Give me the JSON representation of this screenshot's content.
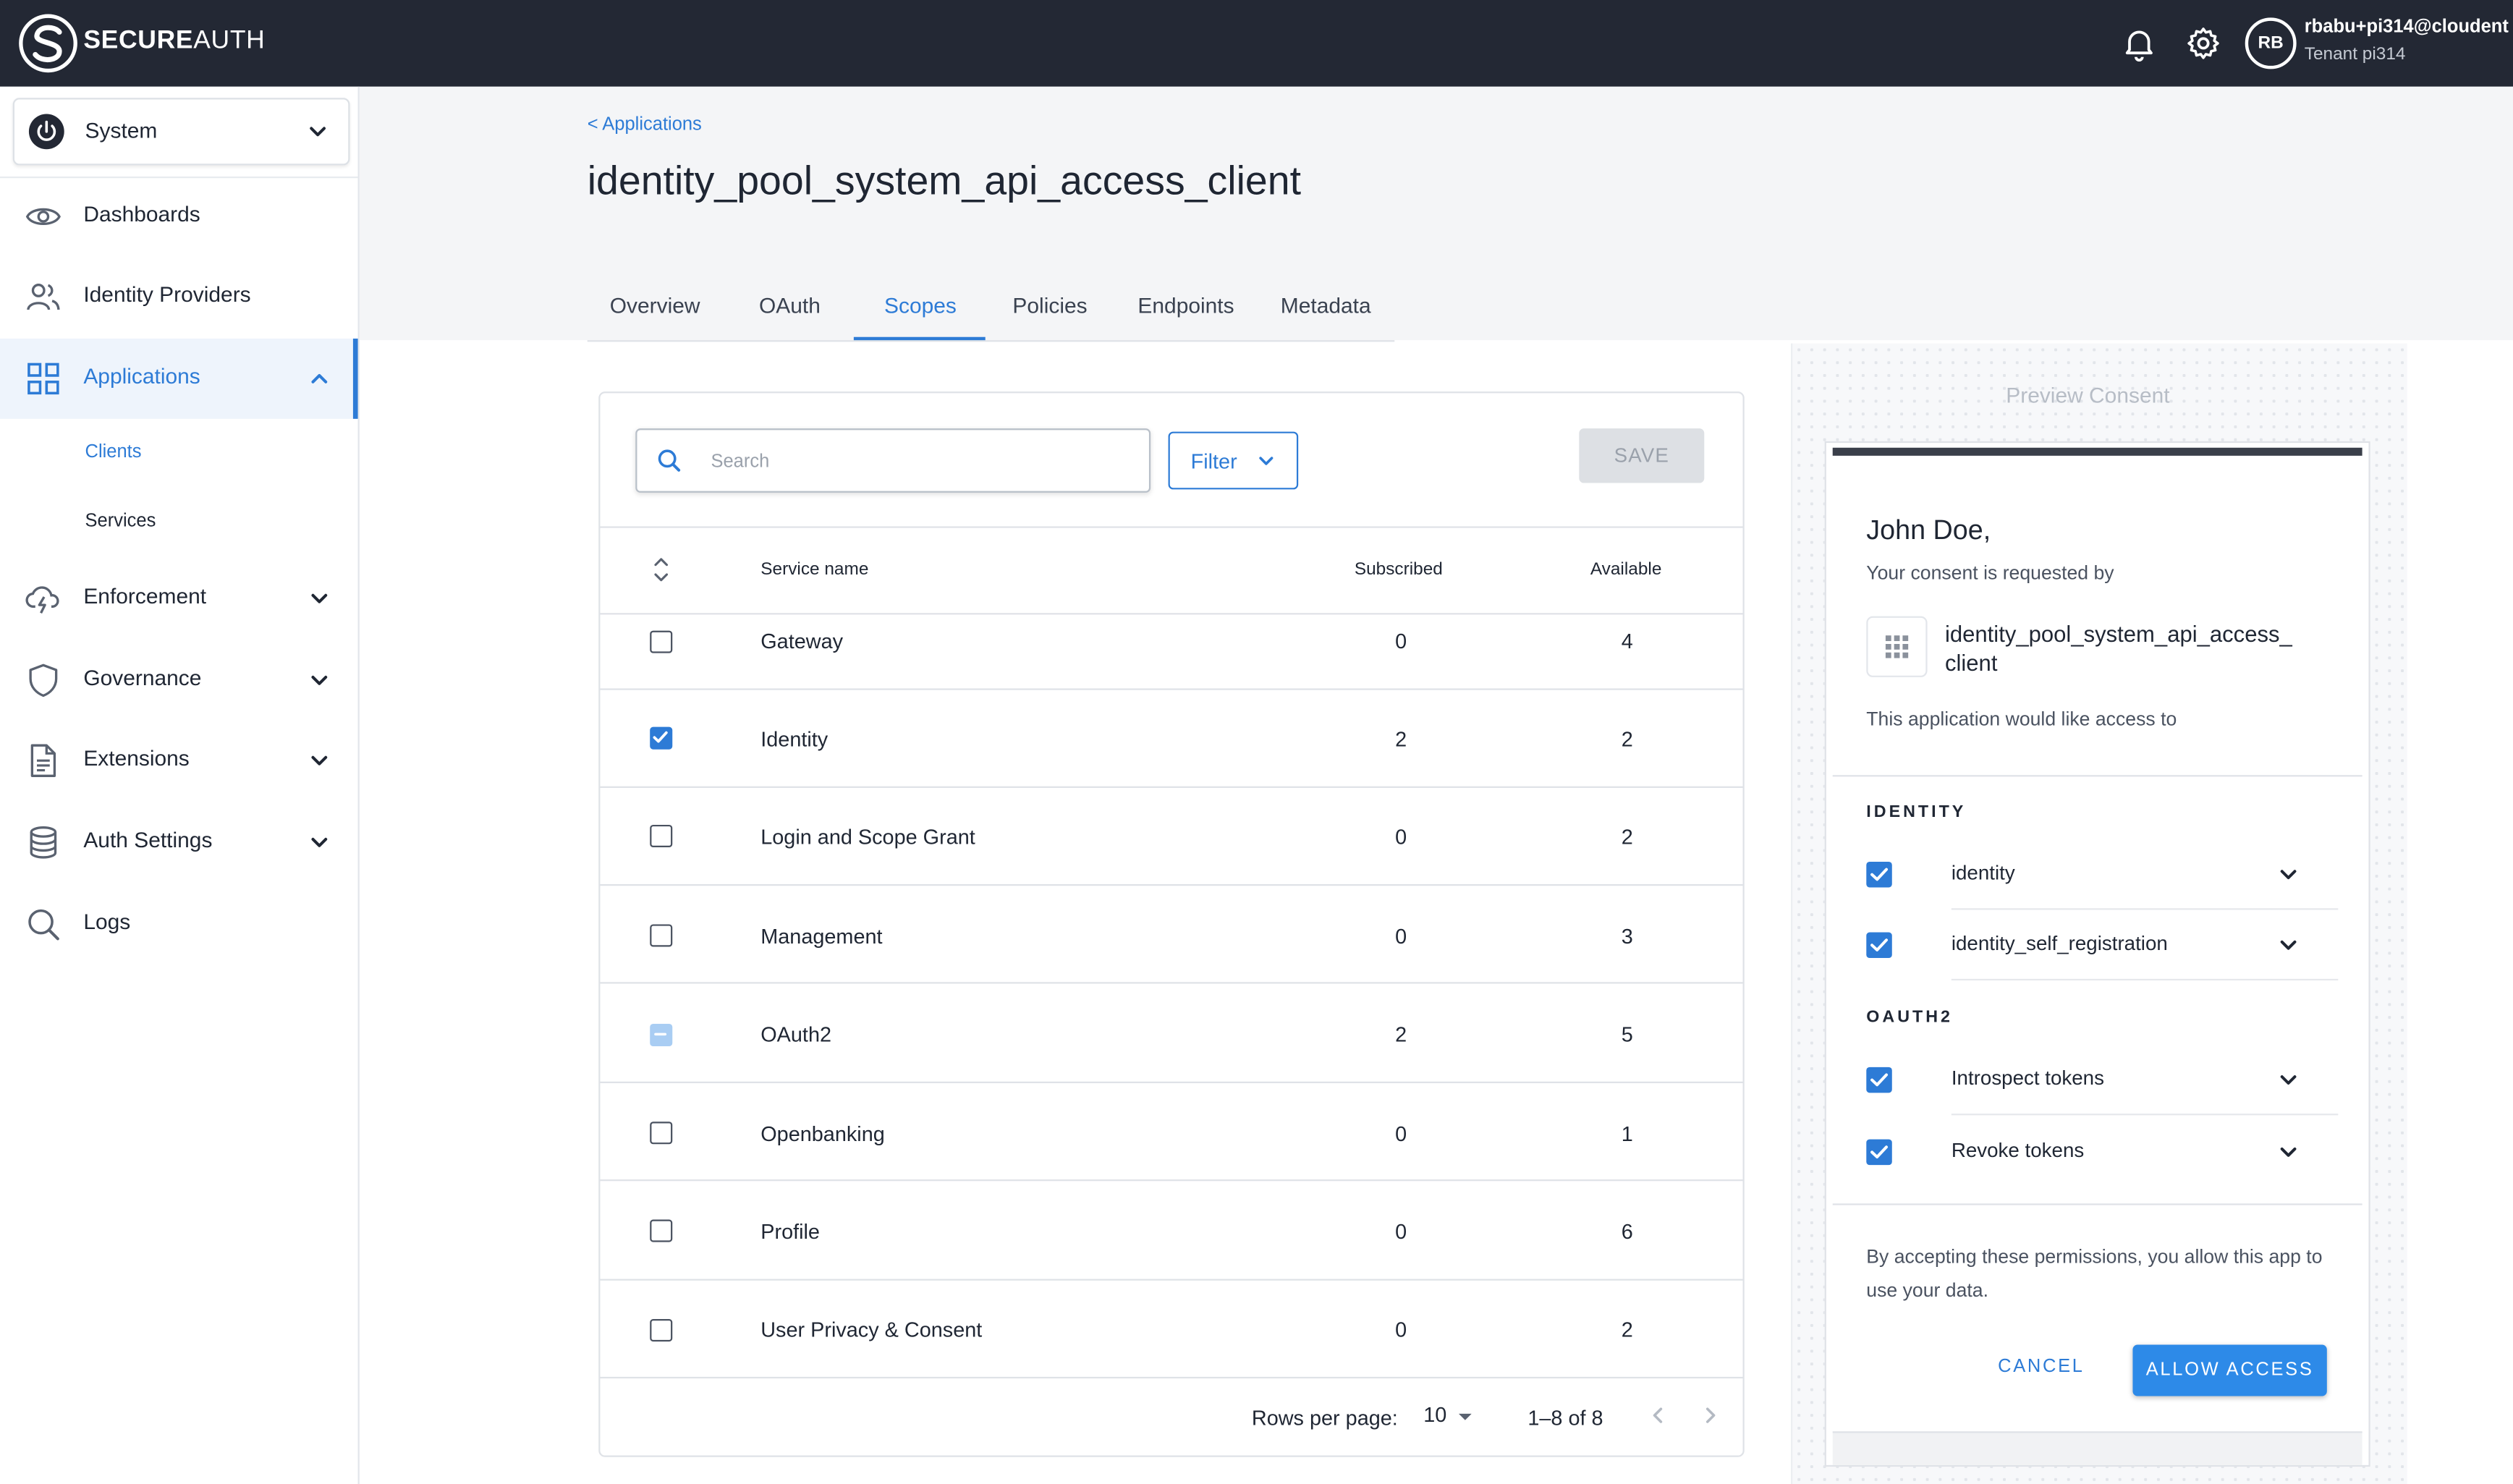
{
  "topbar": {
    "brand_bold": "SECURE",
    "brand_rest": "AUTH",
    "user_initials": "RB",
    "user_name": "rbabu+pi314@cloudent",
    "tenant": "Tenant pi314",
    "icons": [
      "bell-icon",
      "gear-icon"
    ]
  },
  "sidebar": {
    "system_label": "System",
    "items": [
      {
        "label": "Dashboards",
        "icon": "eye-icon"
      },
      {
        "label": "Identity Providers",
        "icon": "users-icon"
      },
      {
        "label": "Applications",
        "icon": "grid-icon"
      },
      {
        "label": "Enforcement",
        "icon": "cloud-lightning-icon"
      },
      {
        "label": "Governance",
        "icon": "shield-icon"
      },
      {
        "label": "Extensions",
        "icon": "document-icon"
      },
      {
        "label": "Auth Settings",
        "icon": "database-icon"
      },
      {
        "label": "Logs",
        "icon": "search-icon"
      }
    ],
    "sub_items": [
      {
        "label": "Clients"
      },
      {
        "label": "Services"
      }
    ]
  },
  "header": {
    "breadcrumb": "< Applications",
    "title": "identity_pool_system_api_access_client",
    "tabs": [
      {
        "label": "Overview"
      },
      {
        "label": "OAuth"
      },
      {
        "label": "Scopes"
      },
      {
        "label": "Policies"
      },
      {
        "label": "Endpoints"
      },
      {
        "label": "Metadata"
      }
    ],
    "active_tab": "Scopes"
  },
  "scopes": {
    "search_placeholder": "Search",
    "filter_label": "Filter",
    "save_label": "SAVE",
    "columns": {
      "service": "Service name",
      "subscribed": "Subscribed",
      "available": "Available"
    },
    "rows": [
      {
        "name": "Gateway",
        "subscribed": "0",
        "available": "4",
        "state": "unchecked"
      },
      {
        "name": "Identity",
        "subscribed": "2",
        "available": "2",
        "state": "checked"
      },
      {
        "name": "Login and Scope Grant",
        "subscribed": "0",
        "available": "2",
        "state": "unchecked"
      },
      {
        "name": "Management",
        "subscribed": "0",
        "available": "3",
        "state": "unchecked"
      },
      {
        "name": "OAuth2",
        "subscribed": "2",
        "available": "5",
        "state": "partial"
      },
      {
        "name": "Openbanking",
        "subscribed": "0",
        "available": "1",
        "state": "unchecked"
      },
      {
        "name": "Profile",
        "subscribed": "0",
        "available": "6",
        "state": "unchecked"
      },
      {
        "name": "User Privacy & Consent",
        "subscribed": "0",
        "available": "2",
        "state": "unchecked"
      }
    ],
    "pagination": {
      "rows_label": "Rows per page:",
      "rows_value": "10",
      "range": "1–8 of 8"
    }
  },
  "preview": {
    "title": "Preview Consent",
    "greeting": "John Doe,",
    "requested_by": "Your consent is requested by",
    "app_name_line1": "identity_pool_system_api_access_",
    "app_name_line2": "client",
    "access_text": "This application would like access to",
    "groups": [
      {
        "name": "IDENTITY",
        "perms": [
          {
            "label": "identity"
          },
          {
            "label": "identity_self_registration"
          }
        ]
      },
      {
        "name": "OAUTH2",
        "perms": [
          {
            "label": "Introspect tokens"
          },
          {
            "label": "Revoke tokens"
          }
        ]
      }
    ],
    "note": "By accepting these permissions, you allow this app to use your data.",
    "cancel_label": "CANCEL",
    "allow_label": "ALLOW ACCESS"
  },
  "colors": {
    "accent": "#2d7bd6",
    "topbar": "#232834",
    "allow_button": "#2d8ae8"
  }
}
